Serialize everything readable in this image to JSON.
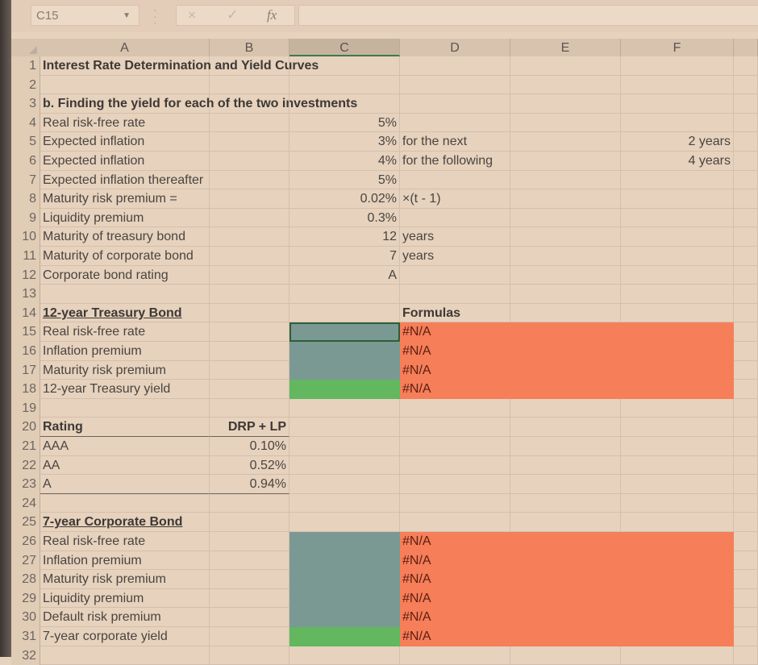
{
  "formula_bar": {
    "name_box": "C15",
    "cancel_icon": "×",
    "enter_icon": "✓",
    "fx_label": "fx",
    "formula": ""
  },
  "colors": {
    "input_cell": "#7b9993",
    "result_cell": "#62b75f",
    "formula_column": "#f67e58"
  },
  "columns": [
    "A",
    "B",
    "C",
    "D",
    "E",
    "F"
  ],
  "selected_column": "C",
  "rows": {
    "r1": {
      "num": "1",
      "A": "Interest Rate Determination and Yield Curves"
    },
    "r2": {
      "num": "2"
    },
    "r3": {
      "num": "3",
      "A": "b.  Finding the yield for each of the two investments"
    },
    "r4": {
      "num": "4",
      "A": "Real risk-free rate",
      "C": "5%"
    },
    "r5": {
      "num": "5",
      "A": "Expected inflation",
      "C": "3%",
      "D": "for the next",
      "F": "2 years"
    },
    "r6": {
      "num": "6",
      "A": "Expected inflation",
      "C": "4%",
      "D": "for the following",
      "F": "4 years"
    },
    "r7": {
      "num": "7",
      "A": "Expected inflation thereafter",
      "C": "5%"
    },
    "r8": {
      "num": "8",
      "A": "Maturity risk premium =",
      "C": "0.02%",
      "D": "×(t - 1)"
    },
    "r9": {
      "num": "9",
      "A": "Liquidity premium",
      "C": "0.3%"
    },
    "r10": {
      "num": "10",
      "A": "Maturity of treasury bond",
      "C": "12",
      "D": "years"
    },
    "r11": {
      "num": "11",
      "A": "Maturity of corporate bond",
      "C": "7",
      "D": "years"
    },
    "r12": {
      "num": "12",
      "A": "Corporate bond rating",
      "C": "A"
    },
    "r13": {
      "num": "13"
    },
    "r14": {
      "num": "14",
      "A": "12-year Treasury Bond",
      "D": "Formulas"
    },
    "r15": {
      "num": "15",
      "A": "Real risk-free rate",
      "C": "",
      "D": "#N/A"
    },
    "r16": {
      "num": "16",
      "A": "Inflation premium",
      "C": "",
      "D": "#N/A"
    },
    "r17": {
      "num": "17",
      "A": "Maturity risk premium",
      "C": "",
      "D": "#N/A"
    },
    "r18": {
      "num": "18",
      "A": "12-year Treasury yield",
      "C": "",
      "D": "#N/A"
    },
    "r19": {
      "num": "19"
    },
    "r20": {
      "num": "20",
      "A": "Rating",
      "B": "DRP + LP"
    },
    "r21": {
      "num": "21",
      "A": "AAA",
      "B": "0.10%"
    },
    "r22": {
      "num": "22",
      "A": "AA",
      "B": "0.52%"
    },
    "r23": {
      "num": "23",
      "A": "A",
      "B": "0.94%"
    },
    "r24": {
      "num": "24"
    },
    "r25": {
      "num": "25",
      "A": "7-year Corporate Bond"
    },
    "r26": {
      "num": "26",
      "A": "Real risk-free rate",
      "C": "",
      "D": "#N/A"
    },
    "r27": {
      "num": "27",
      "A": "Inflation premium",
      "C": "",
      "D": "#N/A"
    },
    "r28": {
      "num": "28",
      "A": "Maturity risk premium",
      "C": "",
      "D": "#N/A"
    },
    "r29": {
      "num": "29",
      "A": "Liquidity premium",
      "C": "",
      "D": "#N/A"
    },
    "r30": {
      "num": "30",
      "A": "Default risk premium",
      "C": "",
      "D": "#N/A"
    },
    "r31": {
      "num": "31",
      "A": "7-year corporate yield",
      "C": "",
      "D": "#N/A"
    },
    "r32": {
      "num": "32"
    }
  }
}
